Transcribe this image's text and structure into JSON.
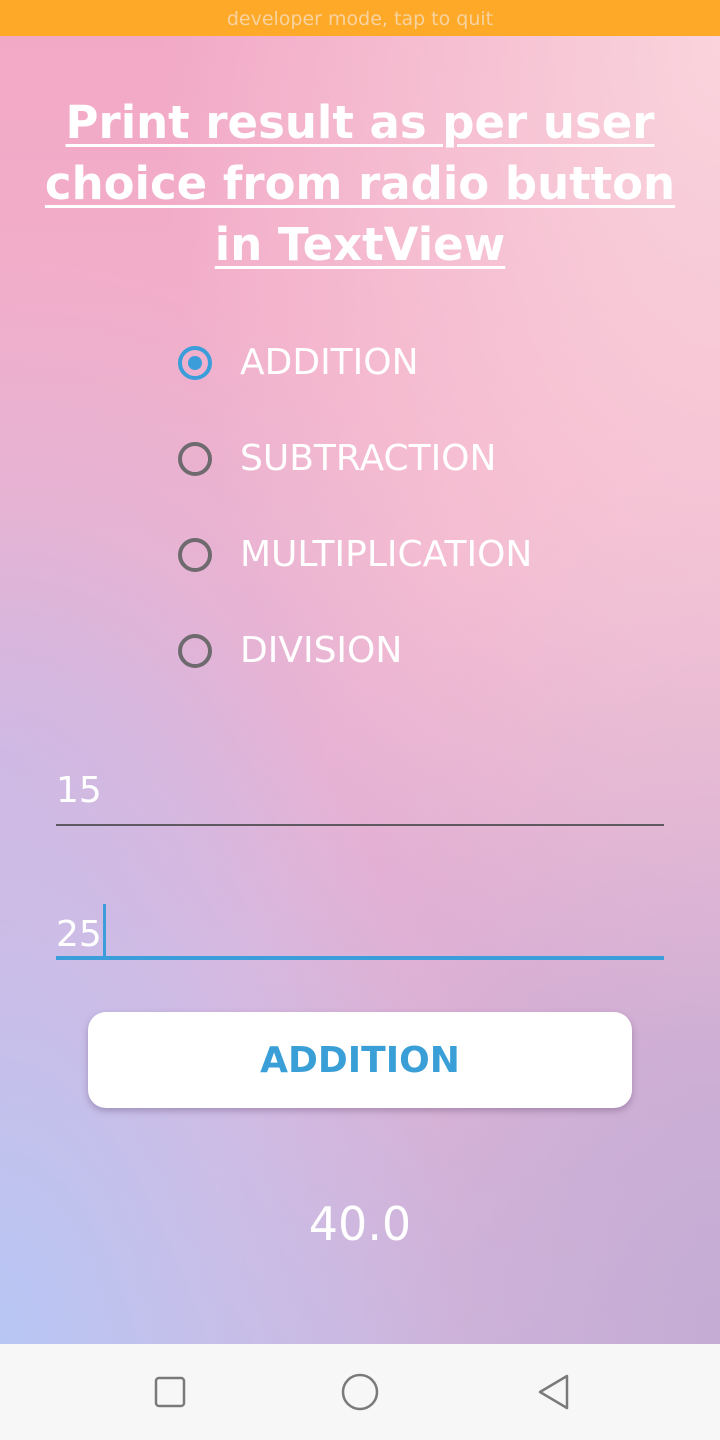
{
  "dev_banner": {
    "text": "developer mode, tap to quit",
    "background": "#FFA928"
  },
  "app": {
    "title": "Print result as per user choice from radio button in TextView",
    "options": [
      {
        "label": "ADDITION",
        "checked": true
      },
      {
        "label": "SUBTRACTION",
        "checked": false
      },
      {
        "label": "MULTIPLICATION",
        "checked": false
      },
      {
        "label": "DIVISION",
        "checked": false
      }
    ],
    "first_number": {
      "value": "15"
    },
    "second_number": {
      "value": "25",
      "focused": true
    },
    "action_button": {
      "label": "ADDITION"
    },
    "result": "40.0",
    "accent_color": "#3B9EDB"
  },
  "nav_bar": {
    "buttons": [
      {
        "icon": "square-recents-icon"
      },
      {
        "icon": "circle-home-icon"
      },
      {
        "icon": "triangle-back-icon"
      }
    ]
  }
}
